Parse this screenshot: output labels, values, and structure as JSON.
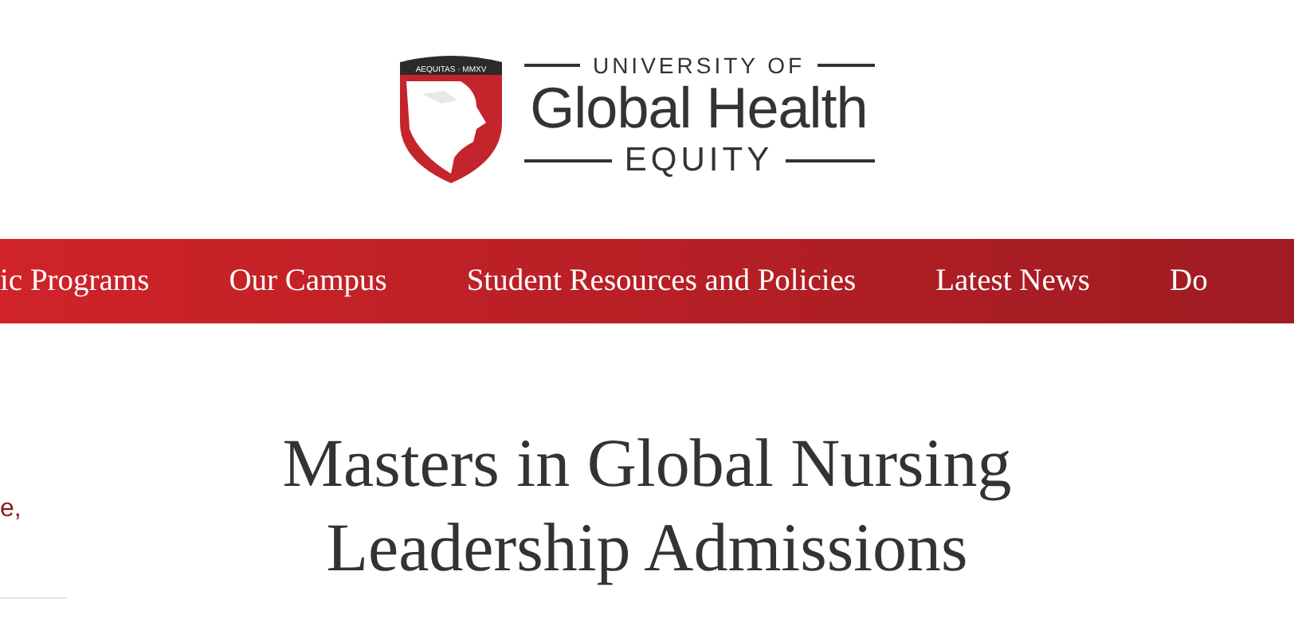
{
  "logo": {
    "seal_text": "AEQUITAS · MMXV",
    "top_line": "UNIVERSITY OF",
    "main": "Global Health",
    "bottom_line": "EQUITY"
  },
  "nav": {
    "items": [
      {
        "label": "ic Programs"
      },
      {
        "label": "Our Campus"
      },
      {
        "label": "Student Resources and Policies"
      },
      {
        "label": "Latest News"
      },
      {
        "label": "Do"
      }
    ]
  },
  "sidebar": {
    "text_fragment": "e,"
  },
  "title": "Masters in Global Nursing Leadership Admissions"
}
